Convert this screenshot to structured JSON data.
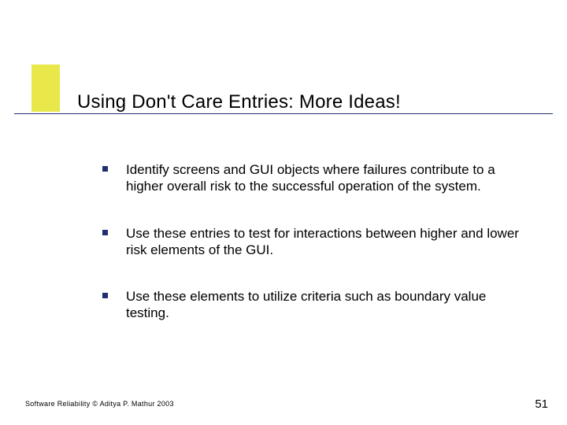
{
  "title": "Using Don't Care Entries: More Ideas!",
  "bullets": [
    "Identify screens and GUI objects where failures contribute to a higher overall risk to the successful operation of the system.",
    "Use these entries to test for interactions between higher and lower risk elements of the GUI.",
    "Use these elements to utilize criteria such as boundary value testing."
  ],
  "footer": "Software Reliability © Aditya P. Mathur 2003",
  "page_number": "51"
}
